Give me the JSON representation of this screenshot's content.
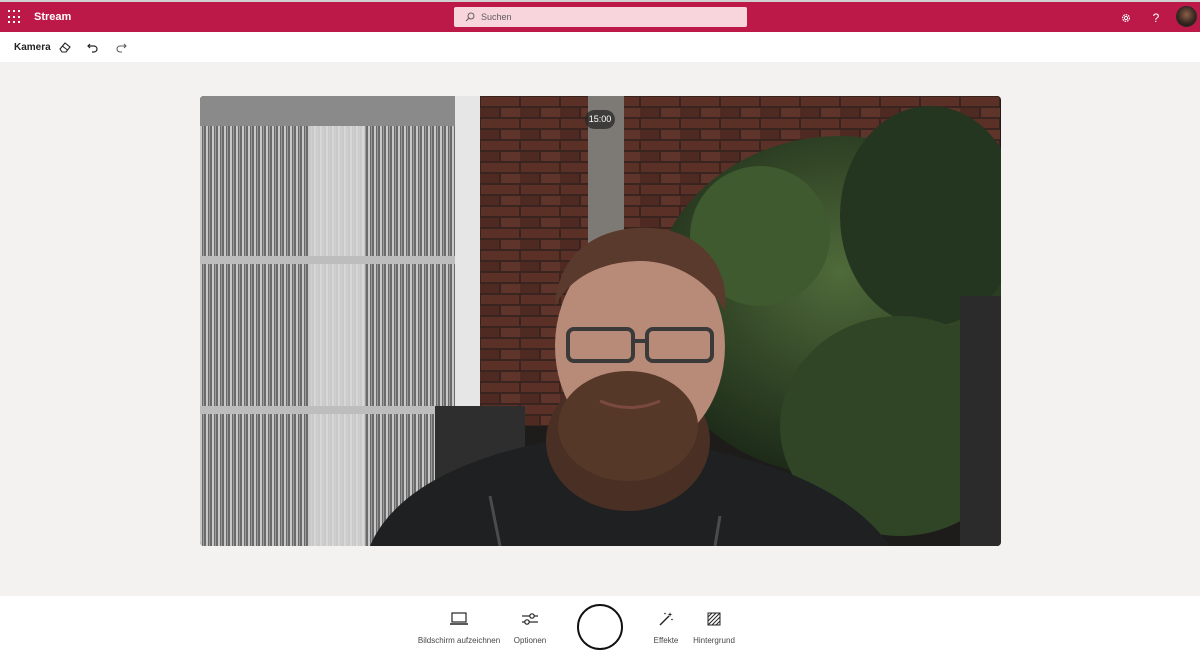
{
  "app": {
    "name": "Stream"
  },
  "search": {
    "placeholder": "Suchen"
  },
  "header": {
    "icons": [
      "app-launcher-icon",
      "settings-icon",
      "help-icon"
    ],
    "help_glyph": "?"
  },
  "toolbar": {
    "title": "Kamera",
    "icons": [
      "eraser-icon",
      "undo-icon",
      "redo-icon"
    ]
  },
  "preview": {
    "timer": "15:00"
  },
  "controls": {
    "screen_label": "Bildschirm aufzeichnen",
    "options_label": "Optionen",
    "effects_label": "Effekte",
    "background_label": "Hintergrund"
  },
  "colors": {
    "brand_bar": "#bc1948",
    "search_bg": "#f8d4dd",
    "canvas": "#f3f2f1"
  }
}
